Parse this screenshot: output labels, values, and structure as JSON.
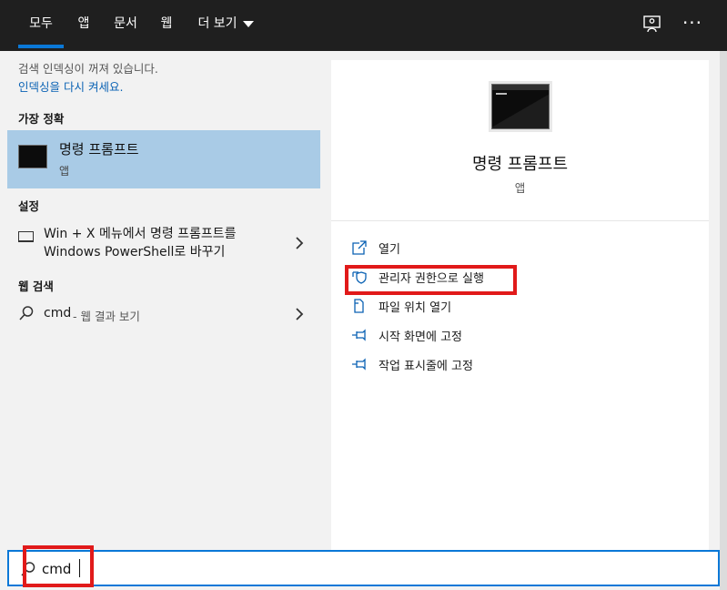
{
  "tabs": [
    {
      "label": "모두",
      "active": true
    },
    {
      "label": "앱"
    },
    {
      "label": "문서"
    },
    {
      "label": "웹"
    },
    {
      "label": "더 보기"
    }
  ],
  "top_icons": [
    "feedback-icon",
    "more-options-icon"
  ],
  "notice": {
    "text": "검색 인덱싱이 꺼져 있습니다.",
    "link": "인덱싱을 다시 켜세요."
  },
  "best_match": {
    "heading": "가장 정확",
    "title": "명령 프롬프트",
    "subtitle": "앱",
    "icon": "command-prompt-icon"
  },
  "settings": {
    "heading": "설정",
    "item_text": "Win + X 메뉴에서 명령 프롬프트를 Windows PowerShell로 바꾸기",
    "icon": "keyboard-icon"
  },
  "web_search": {
    "heading": "웹 검색",
    "term": "cmd",
    "suffix": "- 웹 결과 보기",
    "icon": "search-icon"
  },
  "preview": {
    "title": "명령 프롬프트",
    "subtitle": "앱",
    "actions": [
      {
        "label": "열기",
        "icon": "open-icon"
      },
      {
        "label": "관리자 권한으로 실행",
        "icon": "shield-icon"
      },
      {
        "label": "파일 위치 열기",
        "icon": "file-location-icon"
      },
      {
        "label": "시작 화면에 고정",
        "icon": "pin-icon"
      },
      {
        "label": "작업 표시줄에 고정",
        "icon": "pin-icon"
      }
    ]
  },
  "search": {
    "value": "cmd",
    "placeholder": ""
  },
  "colors": {
    "accent": "#0a78d7",
    "selection": "#a9cbe6",
    "highlight": "#e11a1a",
    "topbar": "#1f1f1f"
  }
}
